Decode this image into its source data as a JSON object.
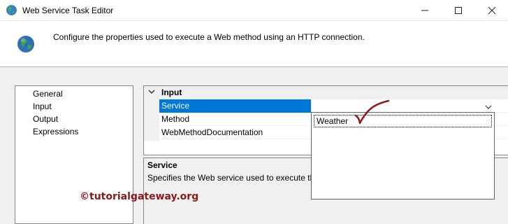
{
  "window": {
    "title": "Web Service Task Editor",
    "icon": "globe-icon",
    "controls": [
      "minimize-icon",
      "maximize-icon",
      "close-icon"
    ]
  },
  "header": {
    "description": "Configure the properties used to execute a Web method using an HTTP connection.",
    "icon": "globe-icon"
  },
  "nav": {
    "items": [
      {
        "label": "General"
      },
      {
        "label": "Input"
      },
      {
        "label": "Output"
      },
      {
        "label": "Expressions"
      }
    ]
  },
  "property_grid": {
    "category": "Input",
    "rows": [
      {
        "name": "Service",
        "value": "",
        "selected": true
      },
      {
        "name": "Method",
        "value": ""
      },
      {
        "name": "WebMethodDocumentation",
        "value": ""
      }
    ]
  },
  "help": {
    "title": "Service",
    "text": "Specifies the Web service used to execute the"
  },
  "dropdown": {
    "options": [
      "Weather"
    ]
  },
  "watermark": {
    "text": "©tutorialgateway.org"
  },
  "colors": {
    "selection": "#0078d7",
    "annotation": "#8b1a1a"
  }
}
